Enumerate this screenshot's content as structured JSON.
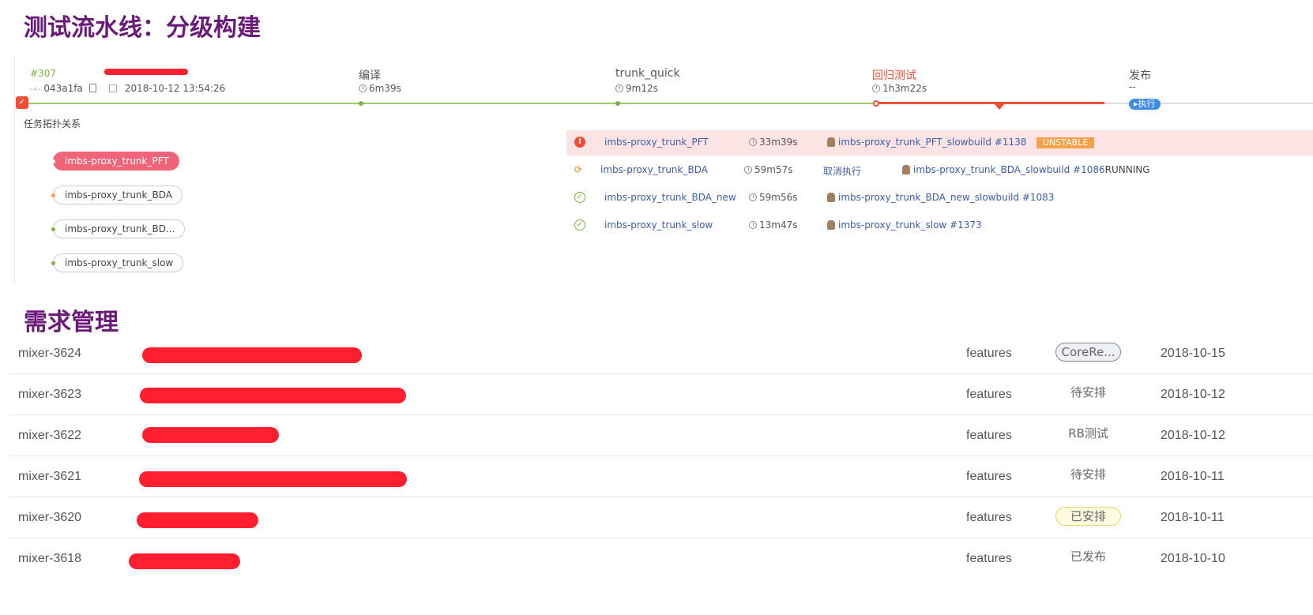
{
  "pipeline_heading": "测试流水线：分级构建",
  "build": {
    "number": "#307",
    "commit": "043a1fa",
    "datetime": "2018-10-12 13:54:26"
  },
  "stages": [
    {
      "name": "编译",
      "time": "6m39s"
    },
    {
      "name": "trunk_quick",
      "time": "9m12s"
    },
    {
      "name": "回归测试",
      "time": "1h3m22s"
    },
    {
      "name": "发布",
      "time": "--",
      "action": "执行"
    }
  ],
  "topology": {
    "label": "任务拓扑关系",
    "nodes": [
      "imbs-proxy_trunk_PFT",
      "imbs-proxy_trunk_BDA",
      "imbs-proxy_trunk_BD...",
      "imbs-proxy_trunk_slow"
    ]
  },
  "jobs": [
    {
      "name": "imbs-proxy_trunk_PFT",
      "duration": "33m39s",
      "action": "",
      "build": "imbs-proxy_trunk_PFT_slowbuild #1138",
      "status": "UNSTABLE"
    },
    {
      "name": "imbs-proxy_trunk_BDA",
      "duration": "59m57s",
      "action": "取消执行",
      "build": "imbs-proxy_trunk_BDA_slowbuild #1086",
      "status": "RUNNING"
    },
    {
      "name": "imbs-proxy_trunk_BDA_new",
      "duration": "59m56s",
      "action": "",
      "build": "imbs-proxy_trunk_BDA_new_slowbuild #1083",
      "status": ""
    },
    {
      "name": "imbs-proxy_trunk_slow",
      "duration": "13m47s",
      "action": "",
      "build": "imbs-proxy_trunk_slow #1373",
      "status": ""
    }
  ],
  "requirements_heading": "需求管理",
  "requirements": [
    {
      "id": "mixer-3624",
      "type": "features",
      "status": "CoreRe...",
      "date": "2018-10-15"
    },
    {
      "id": "mixer-3623",
      "type": "features",
      "status": "待安排",
      "date": "2018-10-12"
    },
    {
      "id": "mixer-3622",
      "type": "features",
      "status": "RB测试",
      "date": "2018-10-12"
    },
    {
      "id": "mixer-3621",
      "type": "features",
      "status": "待安排",
      "date": "2018-10-11"
    },
    {
      "id": "mixer-3620",
      "type": "features",
      "status": "已安排",
      "date": "2018-10-11"
    },
    {
      "id": "mixer-3618",
      "type": "features",
      "status": "已发布",
      "date": "2018-10-10"
    }
  ],
  "colors": {
    "heading": "#6a1b7a",
    "success_line": "#7cb342",
    "failure": "#f04e37",
    "redaction": "#ff1f2e",
    "link": "#3b5ea8"
  }
}
